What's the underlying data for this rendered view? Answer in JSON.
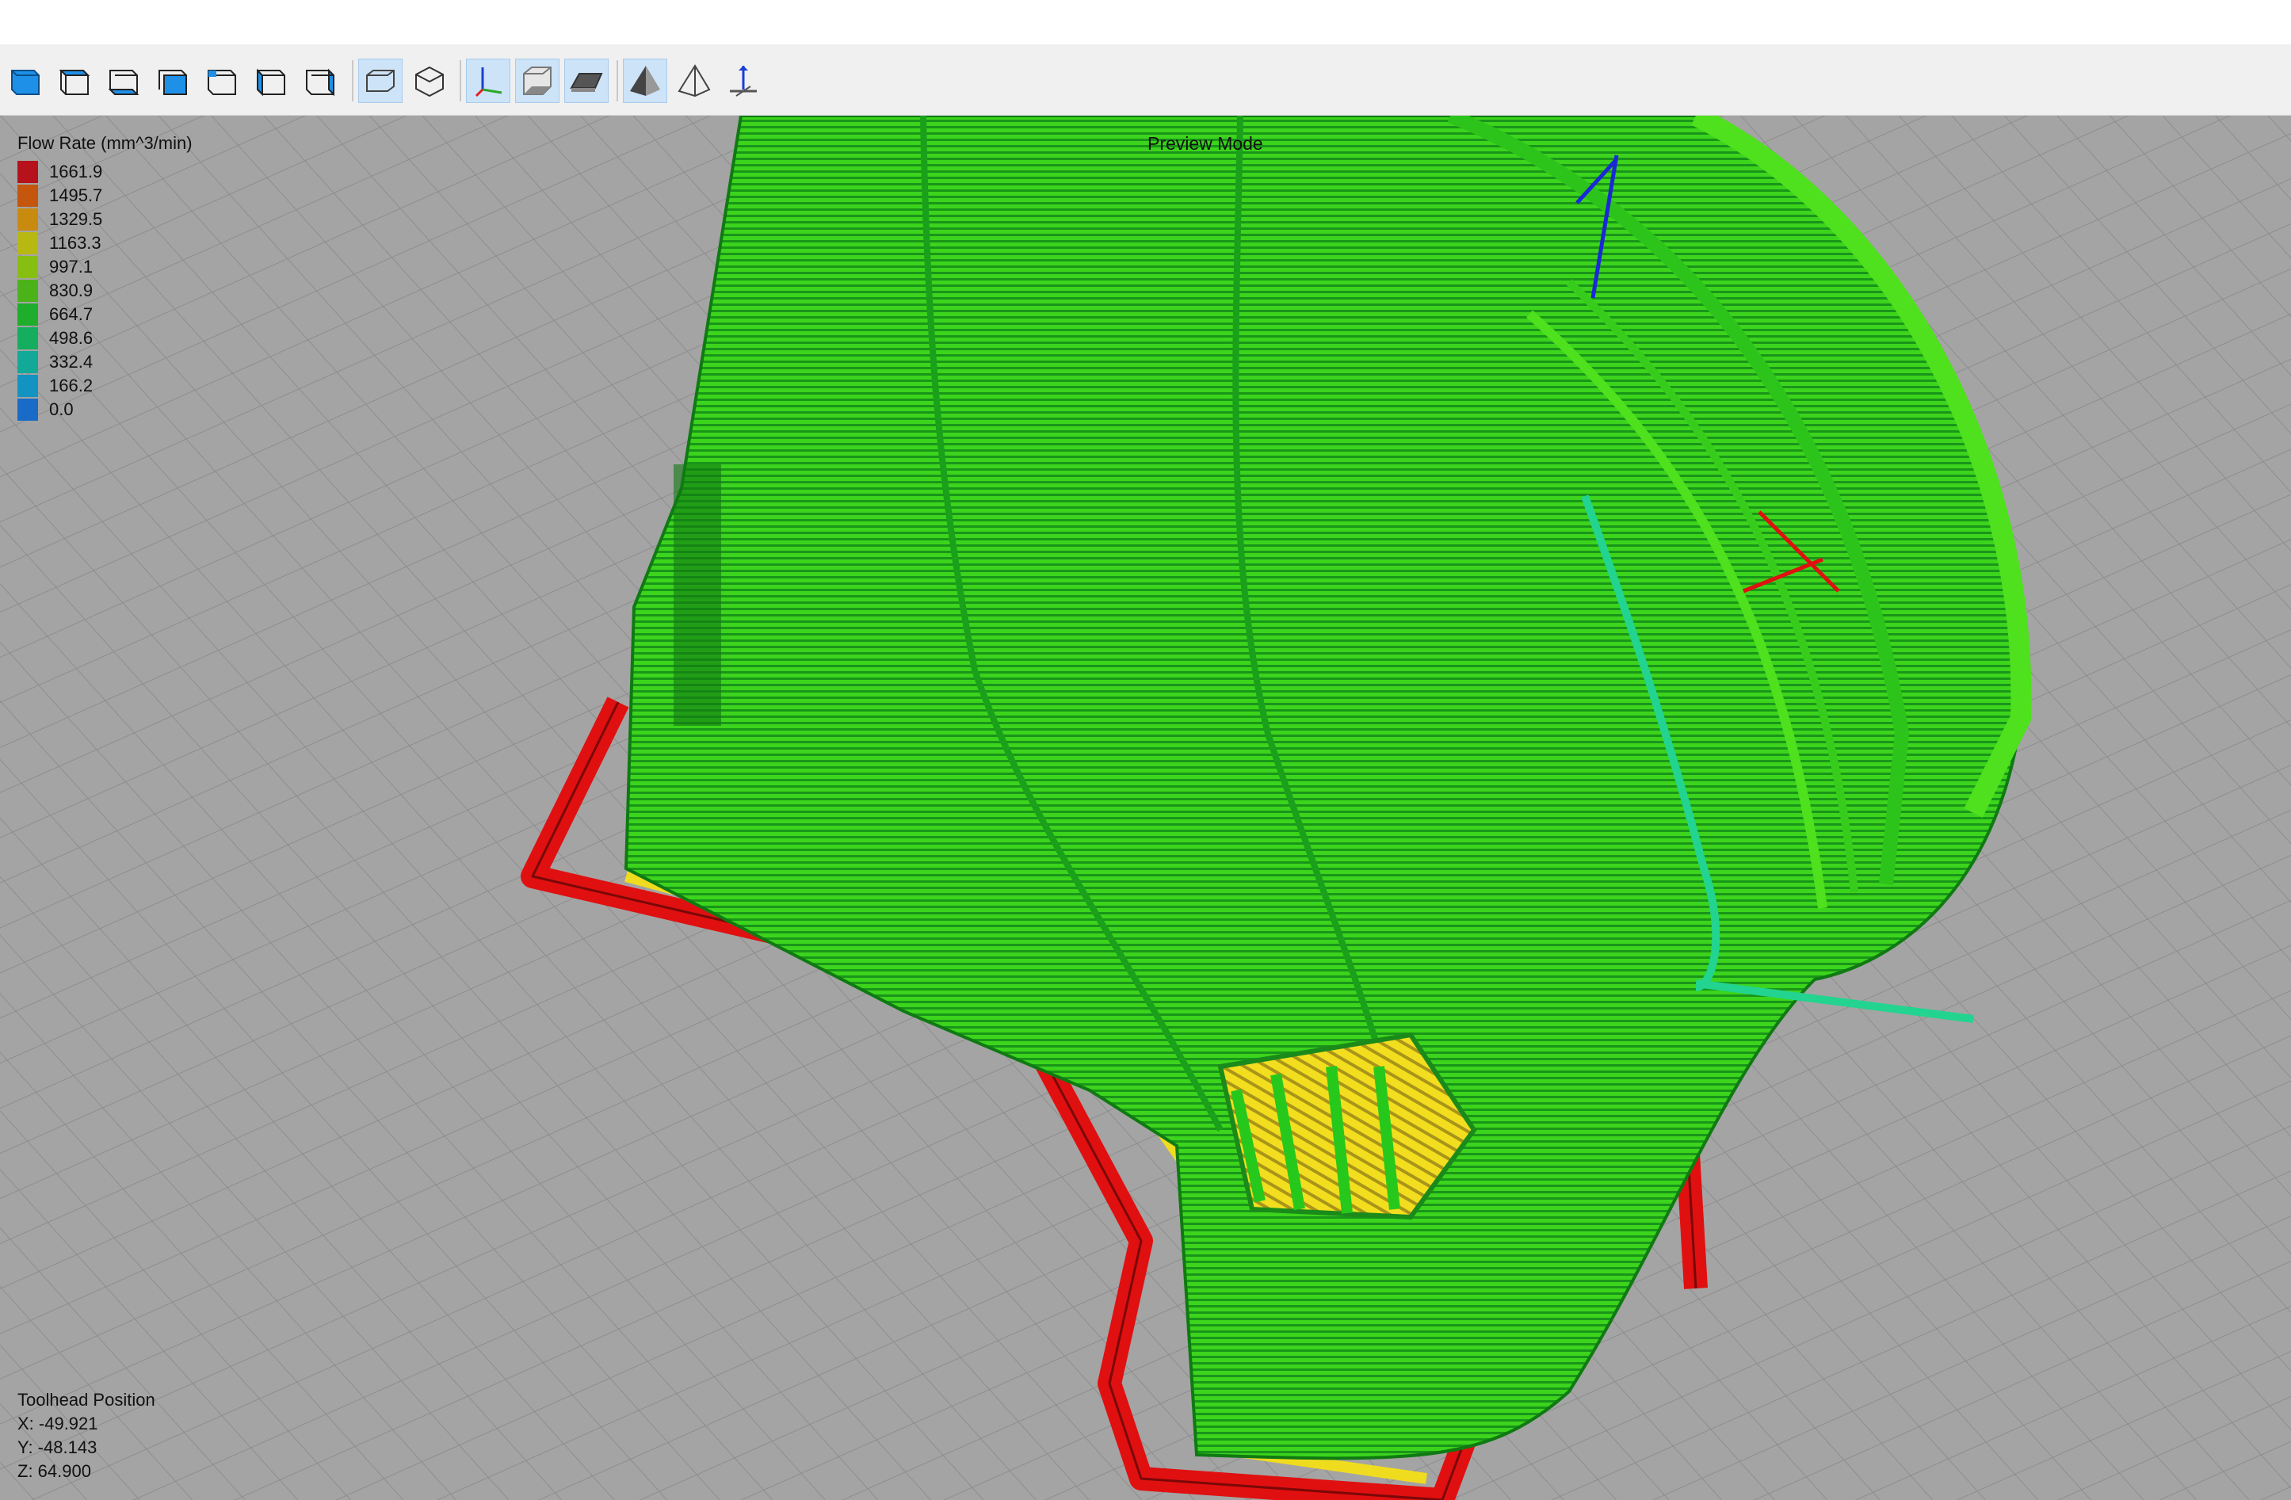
{
  "toolbar": {
    "view_buttons": [
      {
        "name": "view-iso-icon"
      },
      {
        "name": "view-top-icon"
      },
      {
        "name": "view-bottom-icon"
      },
      {
        "name": "view-front-icon"
      },
      {
        "name": "view-back-icon"
      },
      {
        "name": "view-left-icon"
      },
      {
        "name": "view-right-icon"
      }
    ],
    "projection_buttons": [
      {
        "name": "orthographic-icon",
        "active": true
      },
      {
        "name": "perspective-icon",
        "active": false
      }
    ],
    "display_buttons": [
      {
        "name": "axes-icon",
        "active": true
      },
      {
        "name": "build-volume-icon",
        "active": true
      },
      {
        "name": "bed-icon",
        "active": true
      }
    ],
    "mode_buttons": [
      {
        "name": "solid-mode-icon",
        "active": true
      },
      {
        "name": "wireframe-mode-icon",
        "active": false
      },
      {
        "name": "toolhead-icon",
        "active": false
      }
    ]
  },
  "legend": {
    "title": "Flow Rate (mm^3/min)",
    "entries": [
      {
        "value": "1661.9",
        "color": "#b5121b"
      },
      {
        "value": "1495.7",
        "color": "#c4560e"
      },
      {
        "value": "1329.5",
        "color": "#c98a10"
      },
      {
        "value": "1163.3",
        "color": "#b8b812"
      },
      {
        "value": "997.1",
        "color": "#86bf12"
      },
      {
        "value": "830.9",
        "color": "#4cb21a"
      },
      {
        "value": "664.7",
        "color": "#1fae2c"
      },
      {
        "value": "498.6",
        "color": "#14ae5e"
      },
      {
        "value": "332.4",
        "color": "#12a999"
      },
      {
        "value": "166.2",
        "color": "#1393c1"
      },
      {
        "value": "0.0",
        "color": "#1a6bc7"
      }
    ]
  },
  "mode_label": "Preview Mode",
  "toolhead": {
    "title": "Toolhead Position",
    "x": "X: -49.921",
    "y": "Y: -48.143",
    "z": "Z: 64.900"
  },
  "colors": {
    "bed": "#a4a4a4",
    "grid_line": "#8c8c8c",
    "print_green": "#3ad21a",
    "skirt_red": "#e01010",
    "first_layer_yellow": "#f0dc1e"
  }
}
